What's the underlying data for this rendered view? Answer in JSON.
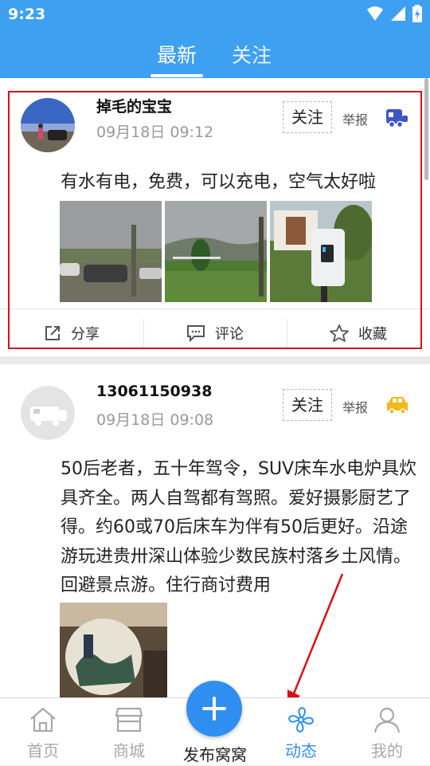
{
  "status_bar": {
    "time": "9:23",
    "icons": [
      "wifi-icon",
      "signal-icon",
      "battery-icon"
    ]
  },
  "header": {
    "tabs": [
      {
        "label": "最新",
        "active": true
      },
      {
        "label": "关注",
        "active": false
      }
    ]
  },
  "posts": [
    {
      "username": "掉毛的宝宝",
      "time": "09月18日 09:12",
      "follow_label": "关注",
      "report_label": "举报",
      "badge_icon": "caravan-icon",
      "text": "有水有电，免费，可以充电，空气太好啦",
      "photos": [
        "photo-parking-lot",
        "photo-grass-field",
        "photo-charging-station"
      ],
      "actions": [
        {
          "label": "分享",
          "icon": "share-icon"
        },
        {
          "label": "评论",
          "icon": "comment-icon"
        },
        {
          "label": "收藏",
          "icon": "star-icon"
        }
      ]
    },
    {
      "username": "13061150938",
      "time": "09月18日 09:08",
      "follow_label": "关注",
      "report_label": "举报",
      "badge_icon": "car-icon",
      "text": "50后老者，五十年驾令，SUV床车水电炉具炊具齐全。两人自驾都有驾照。爱好摄影厨艺了得。约60或70后床车为伴有50后更好。沿途游玩进贵卅深山体验少数民族村落乡土风情。回避景点游。住行商讨费用",
      "photos": [
        "photo-painting-plate"
      ]
    }
  ],
  "bottom_nav": {
    "items": [
      {
        "label": "首页",
        "icon": "home-icon"
      },
      {
        "label": "商城",
        "icon": "shop-icon"
      },
      {
        "label": "动态",
        "icon": "fan-icon",
        "active": true
      },
      {
        "label": "我的",
        "icon": "user-icon"
      }
    ],
    "publish_label": "发布窝窝"
  },
  "colors": {
    "primary": "#3ea0f0",
    "active": "#2f8ff0",
    "highlight": "#d90f17"
  }
}
